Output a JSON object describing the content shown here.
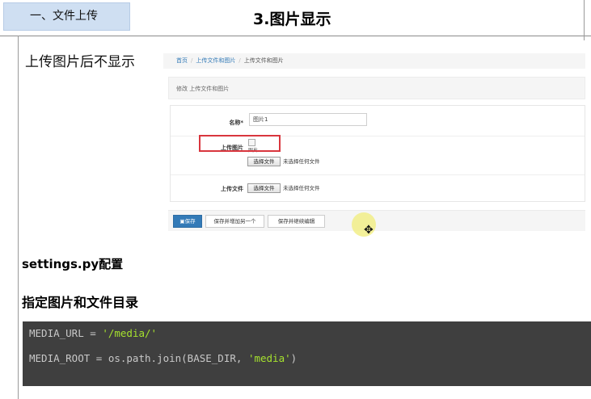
{
  "slide": {
    "section_tab": "一、文件上传",
    "title": "3.图片显示",
    "caption": "上传图片后不显示"
  },
  "admin_form": {
    "breadcrumb": {
      "home": "首页",
      "app": "上传文件和图片",
      "current": "上传文件和图片"
    },
    "panel_title": "修改 上传文件和图片",
    "name_label": "名称*",
    "name_value": "图片1",
    "image_label": "上传图片",
    "image_alt": "图片",
    "file_label": "上传文件",
    "choose_file_button": "选择文件",
    "no_file_text": "未选择任何文件",
    "save_button": "保存",
    "save_add_button": "保存并增加另一个",
    "save_continue_button": "保存并继续编辑"
  },
  "notes": {
    "settings_heading": "settings.py配置",
    "dir_heading": "指定图片和文件目录"
  },
  "code": {
    "line1_prefix": "MEDIA_URL = ",
    "line1_str": "'/media/'",
    "line2_prefix": "MEDIA_ROOT = os.path.join(BASE_DIR, ",
    "line2_str": "'media'",
    "line2_suffix": ")"
  },
  "icons": {
    "cursor": "move-cursor-icon",
    "broken_image": "broken-image-icon"
  },
  "colors": {
    "tab_bg": "#cfdff2",
    "highlight": "#d9363e",
    "primary": "#337ab7",
    "code_bg": "#3f3f3f",
    "code_string": "#a6e22e"
  }
}
